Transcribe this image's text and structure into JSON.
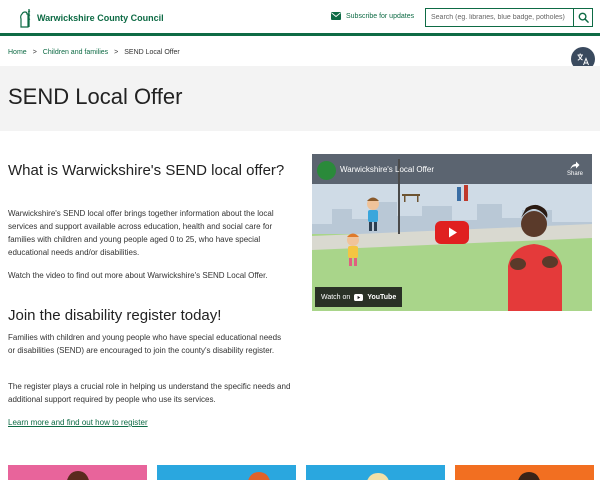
{
  "header": {
    "logo_text": "Warwickshire County Council",
    "subscribe_label": "Subscribe for updates",
    "search_placeholder": "Search (eg. libraries, blue badge, potholes)",
    "brand_color": "#0e6b45"
  },
  "breadcrumb": {
    "items": [
      "Home",
      "Children and families",
      "SEND Local Offer"
    ],
    "separator": ">"
  },
  "page": {
    "title": "SEND Local Offer"
  },
  "main": {
    "section1": {
      "heading": "What is Warwickshire's SEND local offer?",
      "paragraphs": [
        "Warwickshire's SEND local offer brings together information about the local services and support available across education, health and social care for families with children and young people aged 0 to 25, who have special educational needs and/or disabilities.",
        "Watch the video to find out more about Warwickshire's SEND Local Offer."
      ]
    },
    "section2": {
      "heading": "Join the disability register today!",
      "paragraphs": [
        "Families with children and young people who have special educational needs or disabilities (SEND) are encouraged to join the county's disability register.",
        "The register plays a crucial role in helping us understand the specific needs and additional support required by people who use its services."
      ],
      "link_text": "Learn more and find out how to register"
    }
  },
  "video": {
    "title": "Warwickshire's Local Offer",
    "share_label": "Share",
    "watch_on_label": "Watch on",
    "platform_label": "YouTube",
    "icons": [
      "channel-avatar",
      "share-icon",
      "play-icon",
      "youtube-logo-icon"
    ]
  },
  "cards": {
    "colors": [
      "#e8649b",
      "#2aa7df",
      "#2aa7df",
      "#f26f21"
    ]
  },
  "icons": {
    "translate": "translate-icon",
    "search": "search-icon",
    "mail": "mail-icon",
    "logo": "bear-and-ragged-staff-icon"
  }
}
